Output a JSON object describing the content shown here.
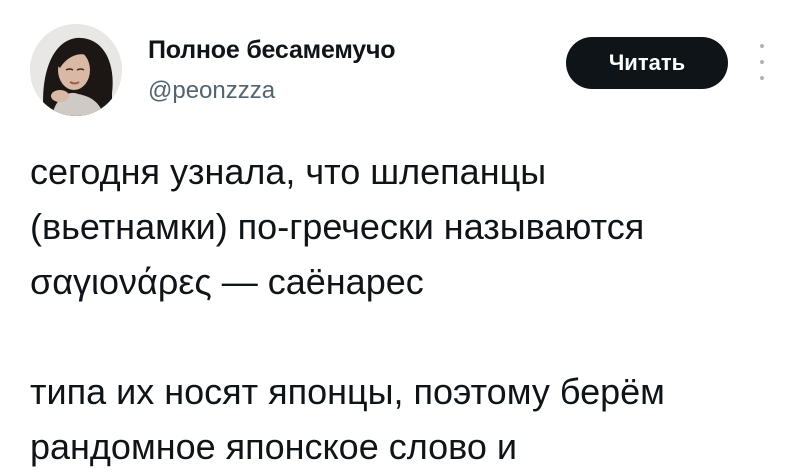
{
  "author": {
    "display_name": "Полное бесамемучо",
    "handle": "@peonzzza"
  },
  "actions": {
    "read_label": "Читать",
    "more_icon": "more-vertical-icon"
  },
  "tweet": {
    "paragraph1": [
      "сегодня узнала, что шлепанцы",
      "(вьетнамки) по-гречески называются",
      "σαγιονάρες — саёнарес"
    ],
    "paragraph2": [
      "типа их носят японцы, поэтому берём",
      "рандомное японское слово и"
    ]
  },
  "colors": {
    "text": "#0f1419",
    "secondary_text": "#536471",
    "button_bg": "#0f1419",
    "button_text": "#ffffff"
  }
}
